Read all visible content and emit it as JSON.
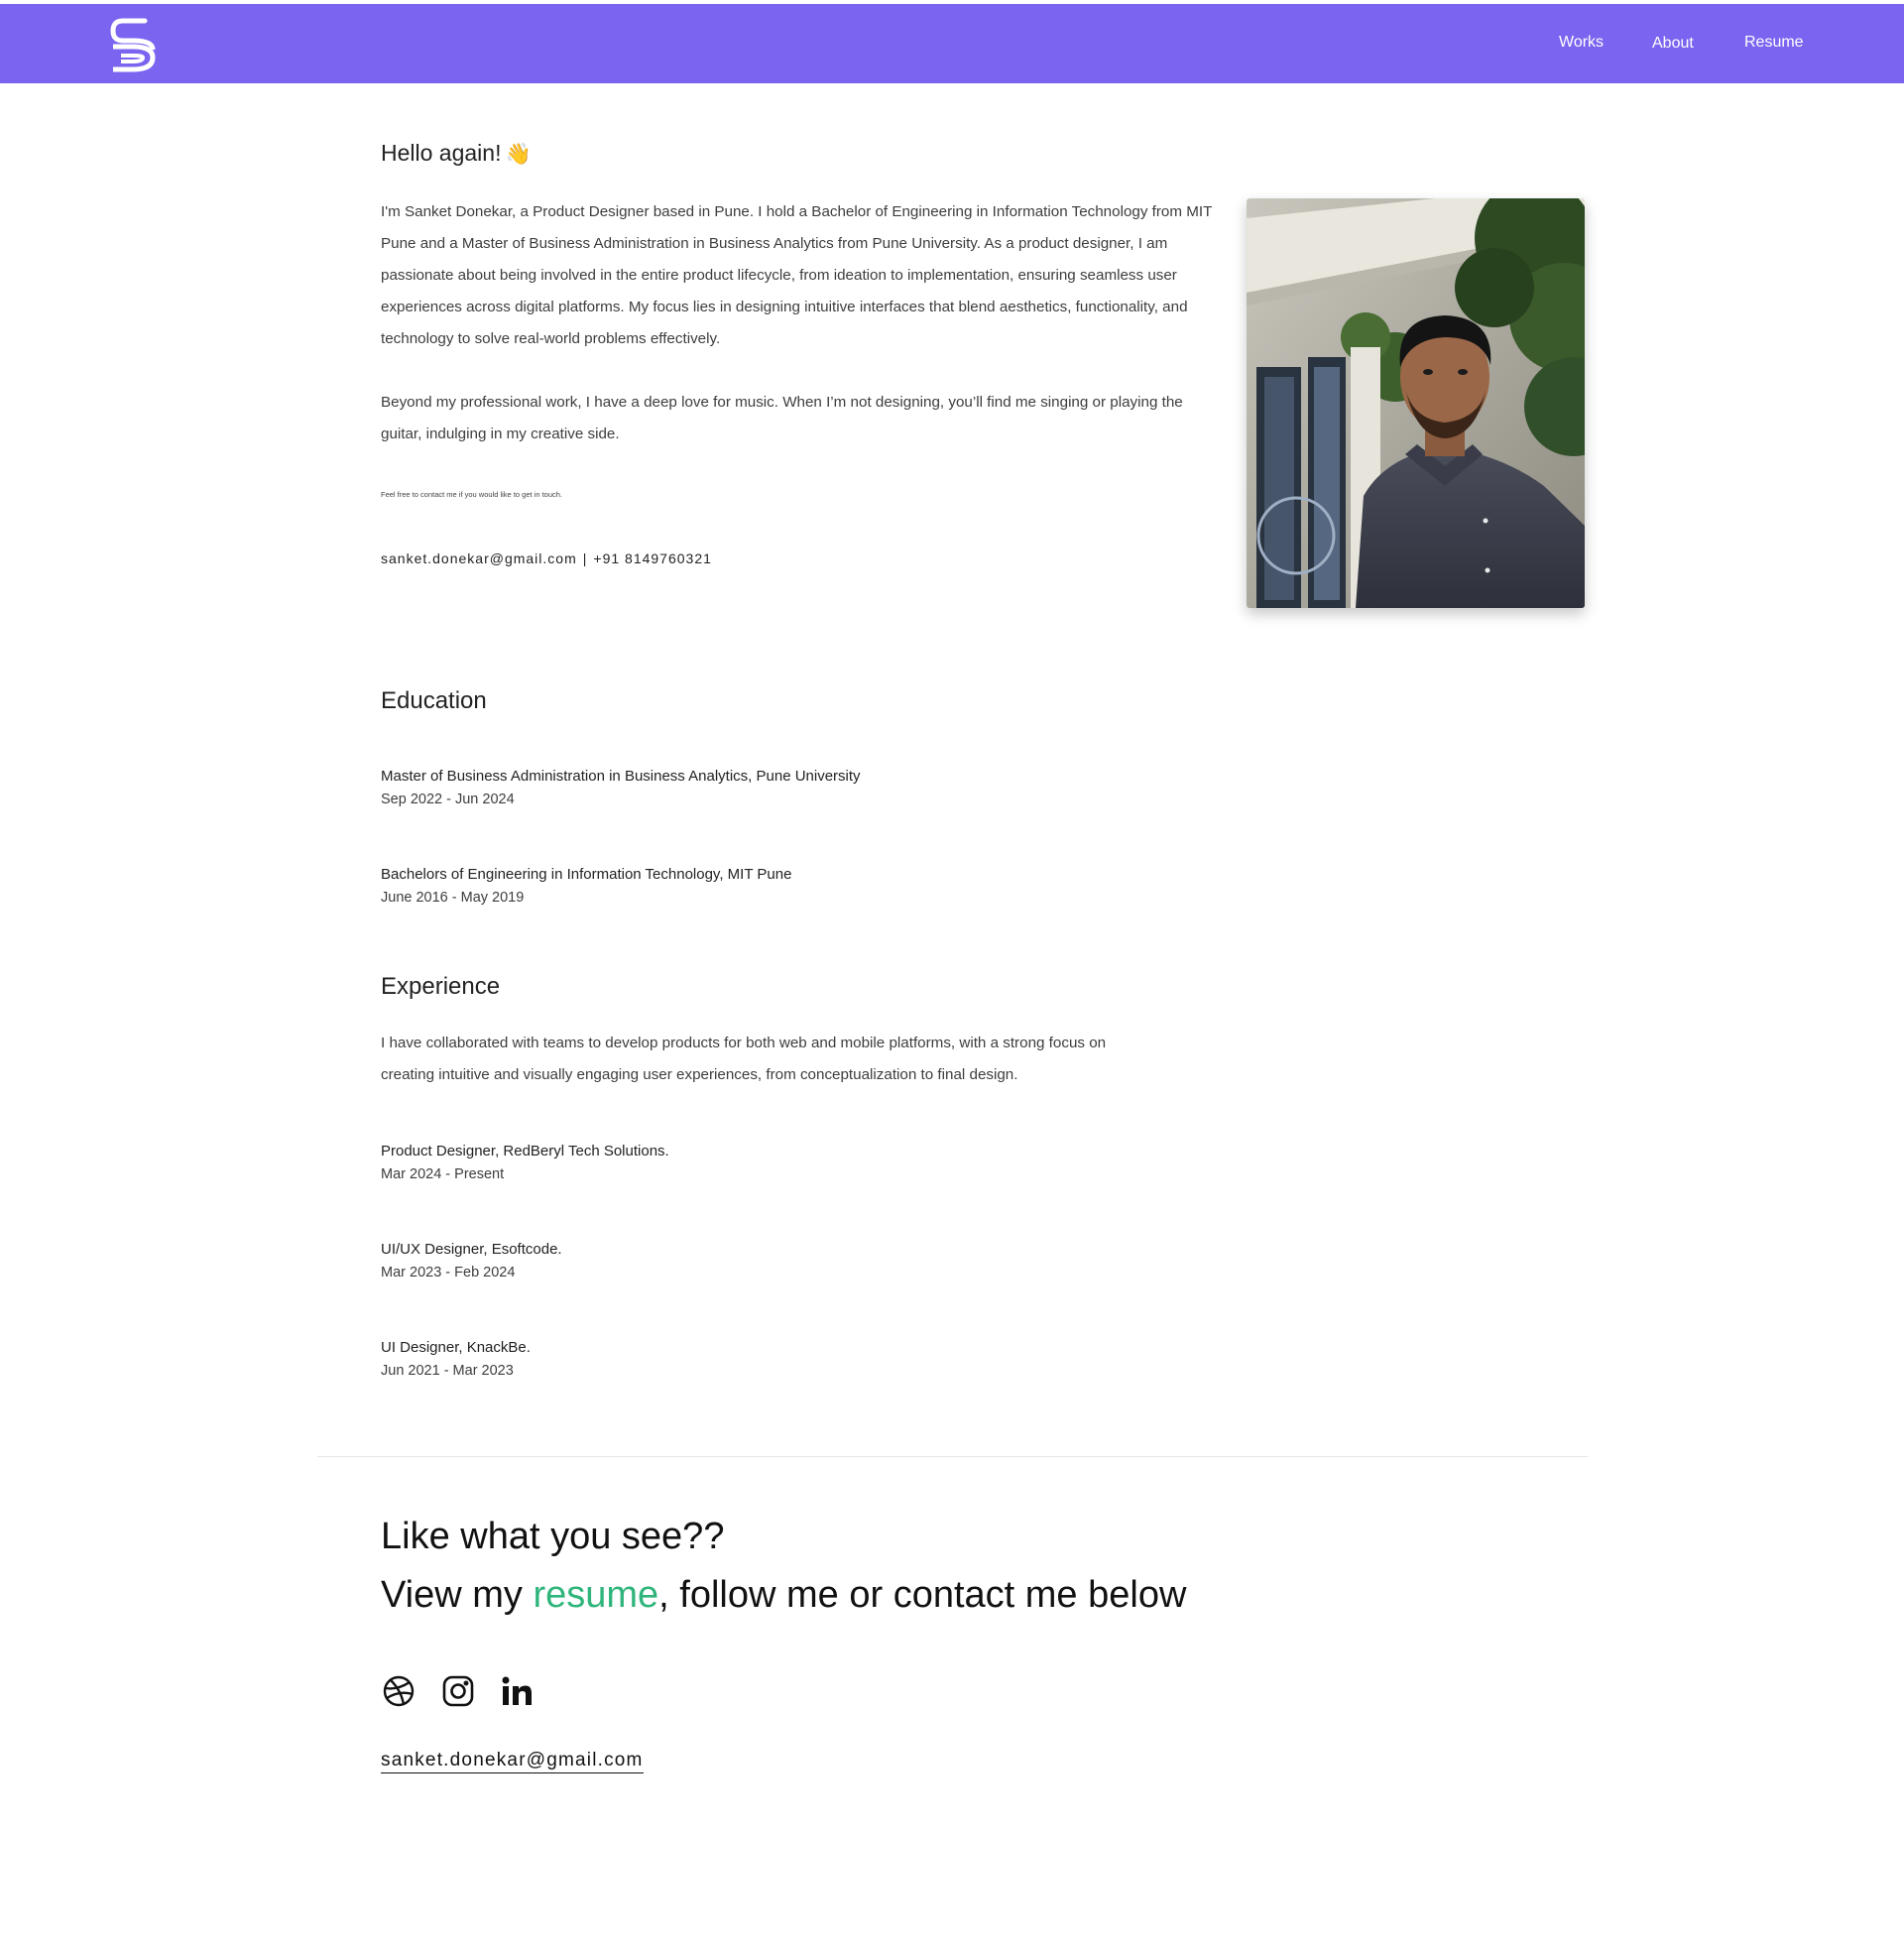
{
  "nav": {
    "logo_letters": "SD",
    "links": [
      "Works",
      "About",
      "Resume"
    ]
  },
  "about": {
    "greeting": "Hello again!",
    "wave_emoji": "👋",
    "intro": "I'm Sanket Donekar, a Product Designer based in Pune. I hold a Bachelor of Engineering in Information Technology from MIT Pune and a Master of Business Administration in Business Analytics from Pune University. As a product designer, I am passionate about being involved in the entire product lifecycle, from ideation to implementation, ensuring seamless user experiences across digital platforms. My focus lies in designing intuitive interfaces that blend aesthetics, functionality, and technology to solve real-world problems effectively.",
    "music": "Beyond my professional work, I have a deep love for music. When I’m not designing, you’ll find me singing or playing the guitar, indulging in my creative side.",
    "contact_note": "Feel free to contact me if you would like to get in touch.",
    "email": "sanket.donekar@gmail.com",
    "separator": "|",
    "phone": "+91 8149760321"
  },
  "education": {
    "heading": "Education",
    "items": [
      {
        "title": "Master of Business Administration in Business Analytics, Pune University",
        "dates": "Sep 2022 - Jun 2024"
      },
      {
        "title": "Bachelors of Engineering in Information Technology, MIT Pune",
        "dates": "June 2016 - May 2019"
      }
    ]
  },
  "experience": {
    "heading": "Experience",
    "intro": "I have collaborated with teams to develop products for both web and mobile platforms, with a strong focus on creating intuitive and visually engaging user experiences, from conceptualization to final design.",
    "items": [
      {
        "title": "Product Designer, RedBeryl Tech Solutions.",
        "dates": "Mar 2024 - Present"
      },
      {
        "title": "UI/UX Designer, Esoftcode.",
        "dates": "Mar 2023 - Feb 2024"
      },
      {
        "title": "UI Designer, KnackBe.",
        "dates": "Jun 2021 - Mar 2023"
      }
    ]
  },
  "footer": {
    "line1": "Like what you see??",
    "line2_prefix": "View my ",
    "line2_link": "resume",
    "line2_suffix": ", follow me or contact me below",
    "social_icons": [
      "dribbble-icon",
      "instagram-icon",
      "linkedin-icon"
    ],
    "email": "sanket.donekar@gmail.com"
  },
  "colors": {
    "header_bg": "#7b64f0",
    "accent_green": "#2fb57b",
    "text_dark": "#222222"
  }
}
